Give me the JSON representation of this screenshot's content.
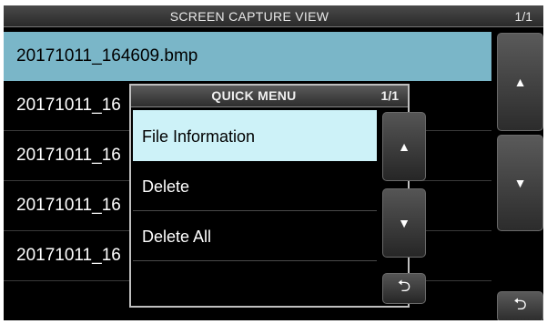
{
  "window": {
    "title": "SCREEN CAPTURE VIEW",
    "page": "1/1"
  },
  "files": [
    {
      "name": "20171011_164609.bmp",
      "selected": true
    },
    {
      "name": "20171011_16"
    },
    {
      "name": "20171011_16"
    },
    {
      "name": "20171011_16"
    },
    {
      "name": "20171011_16"
    }
  ],
  "side_buttons": {
    "up": "▲",
    "down": "▼",
    "back": "⮌"
  },
  "quick_menu": {
    "title": "QUICK MENU",
    "page": "1/1",
    "items": [
      {
        "label": "File Information",
        "selected": true
      },
      {
        "label": "Delete"
      },
      {
        "label": "Delete All"
      },
      {
        "label": ""
      }
    ],
    "up": "▲",
    "down": "▼",
    "back": "⮌"
  },
  "colors": {
    "selected_row": "#7ab6c8",
    "menu_selected": "#cdf2f8"
  }
}
